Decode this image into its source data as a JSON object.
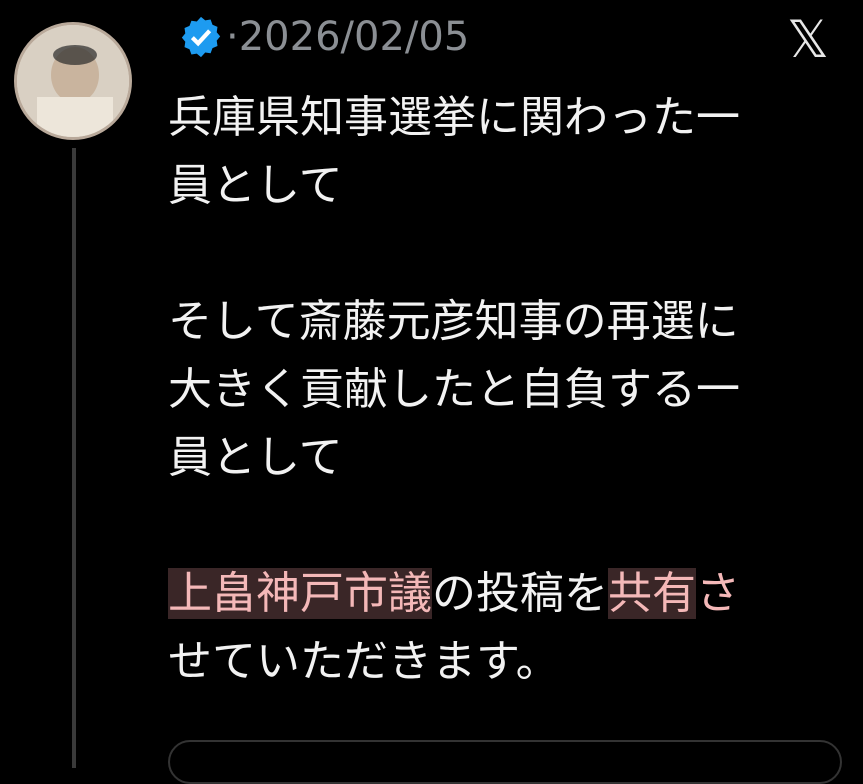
{
  "post": {
    "date": "·2026/02/05",
    "platform_icon": "x-logo-icon",
    "verified_icon": "verified-badge-icon",
    "line1": "兵庫県知事選挙に関わった一",
    "line2": "員として",
    "line3": "そして斎藤元彦知事の再選に",
    "line4": "大きく貢献したと自負する一",
    "line5": "員として",
    "line6_highlight": "上畠神戸市議",
    "line6_mid": "の投稿を",
    "line6_highlight2": "共有",
    "line6_end": "さ",
    "line7": "せていただきます。"
  },
  "colors": {
    "background": "#000000",
    "text": "#f2f2f2",
    "date": "#8b8f94",
    "verified": "#1d9bf0",
    "highlight": "#f4b8b8"
  }
}
